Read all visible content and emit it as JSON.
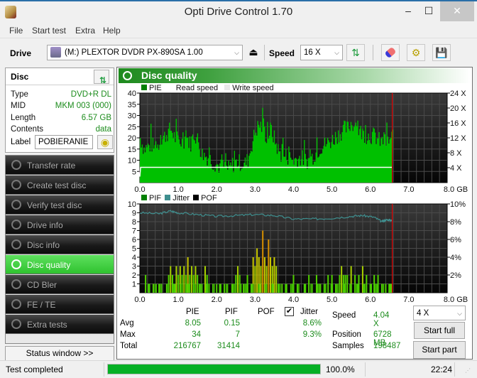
{
  "window": {
    "title": "Opti Drive Control 1.70",
    "controls": {
      "minimize": "‒",
      "maximize": "☐",
      "close": "✕"
    }
  },
  "menu": [
    "File",
    "Start test",
    "Extra",
    "Help"
  ],
  "toolbar": {
    "drive_label": "Drive",
    "drive_value": "(M:)  PLEXTOR DVDR   PX-890SA 1.00",
    "speed_label": "Speed",
    "speed_value": "16 X",
    "icons": [
      "eject-icon",
      "refresh-icon",
      "erase-icon",
      "settings-icon",
      "save-icon"
    ]
  },
  "disc": {
    "header": "Disc",
    "fields": [
      {
        "key": "Type",
        "value": "DVD+R DL"
      },
      {
        "key": "MID",
        "value": "MKM 003 (000)"
      },
      {
        "key": "Length",
        "value": "6.57 GB"
      },
      {
        "key": "Contents",
        "value": "data"
      }
    ],
    "label_key": "Label",
    "label_value": "POBIERANIE"
  },
  "nav": {
    "items": [
      {
        "label": "Transfer rate",
        "active": false
      },
      {
        "label": "Create test disc",
        "active": false
      },
      {
        "label": "Verify test disc",
        "active": false
      },
      {
        "label": "Drive info",
        "active": false
      },
      {
        "label": "Disc info",
        "active": false
      },
      {
        "label": "Disc quality",
        "active": true
      },
      {
        "label": "CD Bler",
        "active": false
      },
      {
        "label": "FE / TE",
        "active": false
      },
      {
        "label": "Extra tests",
        "active": false
      }
    ],
    "status_window_button": "Status window >>"
  },
  "panel": {
    "title": "Disc quality"
  },
  "chart_data": [
    {
      "type": "area",
      "title": "PIE",
      "legend": [
        {
          "name": "PIE",
          "color": "#008000"
        },
        {
          "name": "Read speed",
          "color": "#ffffff"
        },
        {
          "name": "Write speed",
          "color": "#e8e8e8"
        }
      ],
      "legend_placement": "top-left",
      "xlabel": "GB",
      "xlim": [
        0,
        8
      ],
      "x_ticks": [
        "0.0",
        "1.0",
        "2.0",
        "3.0",
        "4.0",
        "5.0",
        "6.0",
        "7.0",
        "8.0 GB"
      ],
      "ylim": [
        0,
        40
      ],
      "y_ticks": [
        "5",
        "10",
        "15",
        "20",
        "25",
        "30",
        "35",
        "40"
      ],
      "y2lim": [
        0,
        24
      ],
      "y2_ticks": [
        "4 X",
        "8 X",
        "12 X",
        "16 X",
        "20 X",
        "24 X"
      ],
      "end_marker_gb": 6.57,
      "series": [
        {
          "name": "PIE",
          "color": "#00c000",
          "x": [
            0.0,
            0.1,
            0.2,
            0.3,
            0.4,
            0.5,
            0.6,
            0.7,
            0.8,
            0.9,
            1.0,
            1.1,
            1.2,
            1.3,
            1.4,
            1.5,
            1.6,
            1.7,
            1.8,
            1.9,
            2.0,
            2.1,
            2.2,
            2.3,
            2.4,
            2.5,
            2.6,
            2.7,
            2.8,
            2.9,
            3.0,
            3.1,
            3.2,
            3.3,
            3.4,
            3.5,
            3.6,
            3.7,
            3.8,
            3.9,
            4.0,
            4.1,
            4.2,
            4.3,
            4.4,
            4.5,
            4.6,
            4.7,
            4.8,
            4.9,
            5.0,
            5.1,
            5.2,
            5.3,
            5.4,
            5.5,
            5.6,
            5.7,
            5.8,
            5.9,
            6.0,
            6.1,
            6.2,
            6.3,
            6.4,
            6.5,
            6.57
          ],
          "values": [
            20,
            15,
            16,
            17,
            15,
            18,
            20,
            22,
            24,
            20,
            19,
            18,
            21,
            17,
            22,
            19,
            13,
            12,
            11,
            9,
            8,
            7,
            7,
            6,
            8,
            9,
            9,
            8,
            10,
            17,
            23,
            26,
            24,
            20,
            24,
            19,
            14,
            12,
            12,
            11,
            10,
            11,
            11,
            10,
            10,
            12,
            14,
            16,
            17,
            18,
            19,
            21,
            22,
            24,
            24,
            27,
            25,
            23,
            22,
            21,
            21,
            21,
            19,
            18,
            18,
            19,
            21
          ]
        },
        {
          "name": "Read speed",
          "color": "#ffffff",
          "x": [
            0.0,
            0.02,
            6.57
          ],
          "values": [
            1.6,
            4.1,
            4.1
          ]
        }
      ]
    },
    {
      "type": "bar",
      "title": "PIF / Jitter",
      "legend": [
        {
          "name": "PIF",
          "color": "#008000"
        },
        {
          "name": "Jitter",
          "color": "#3f8f8f"
        },
        {
          "name": "POF",
          "color": "#000000"
        }
      ],
      "legend_placement": "top-left",
      "xlabel": "GB",
      "xlim": [
        0,
        8
      ],
      "x_ticks": [
        "0.0",
        "1.0",
        "2.0",
        "3.0",
        "4.0",
        "5.0",
        "6.0",
        "7.0",
        "8.0 GB"
      ],
      "ylim": [
        0,
        10
      ],
      "y_ticks": [
        "1",
        "2",
        "3",
        "4",
        "5",
        "6",
        "7",
        "8",
        "9",
        "10"
      ],
      "y2lim": [
        0,
        10
      ],
      "y2_ticks": [
        "2%",
        "4%",
        "6%",
        "8%",
        "10%"
      ],
      "end_marker_gb": 6.57,
      "series": [
        {
          "name": "PIF",
          "x": [
            0.15,
            0.25,
            0.35,
            0.5,
            0.7,
            0.75,
            0.8,
            0.85,
            0.9,
            0.95,
            1.0,
            1.05,
            1.1,
            1.15,
            1.2,
            1.25,
            1.3,
            1.35,
            1.4,
            1.45,
            1.5,
            1.55,
            1.7,
            1.75,
            1.8,
            2.0,
            2.1,
            2.2,
            2.4,
            2.5,
            2.55,
            2.6,
            2.7,
            2.8,
            2.9,
            2.95,
            3.0,
            3.05,
            3.1,
            3.15,
            3.2,
            3.25,
            3.3,
            3.35,
            3.4,
            3.45,
            3.5,
            3.55,
            3.6,
            3.7,
            3.8,
            4.0,
            4.1,
            4.3,
            4.4,
            4.6,
            4.7,
            4.8,
            4.9,
            5.0,
            5.1,
            5.2,
            5.25,
            5.3,
            5.35,
            5.4,
            5.5,
            5.6,
            5.65,
            5.7,
            5.8,
            5.85,
            5.9,
            6.0,
            6.1,
            6.2,
            6.3,
            6.4,
            6.5,
            6.55
          ],
          "values": [
            2,
            1,
            1,
            1,
            1,
            2,
            3,
            2,
            1,
            3,
            2,
            3,
            2,
            3,
            2,
            4,
            2,
            3,
            2,
            3,
            2,
            1,
            3,
            2,
            1,
            1,
            1,
            1,
            1,
            2,
            3,
            2,
            1,
            2,
            1,
            4,
            3,
            5,
            4,
            3,
            7,
            4,
            3,
            6,
            4,
            3,
            4,
            3,
            1,
            1,
            1,
            2,
            1,
            1,
            2,
            2,
            1,
            1,
            2,
            2,
            1,
            2,
            3,
            2,
            2,
            2,
            3,
            2,
            1,
            2,
            3,
            1,
            2,
            1,
            2,
            2,
            1,
            1,
            1,
            1
          ]
        },
        {
          "name": "Jitter",
          "color": "#3f8f8f",
          "x": [
            0.0,
            0.5,
            0.8,
            1.0,
            1.5,
            2.0,
            2.5,
            3.0,
            3.5,
            4.0,
            4.5,
            5.0,
            5.5,
            5.8,
            6.1,
            6.3,
            6.4,
            6.5,
            6.57
          ],
          "values": [
            9.0,
            8.9,
            9.2,
            9.0,
            8.8,
            8.6,
            8.7,
            8.8,
            8.7,
            8.3,
            8.3,
            8.4,
            8.6,
            8.7,
            8.5,
            8.0,
            8.2,
            8.2,
            8.1
          ]
        }
      ]
    }
  ],
  "stats": {
    "headers": [
      "PIE",
      "PIF",
      "POF",
      "Jitter"
    ],
    "jitter_checked": true,
    "rows": [
      {
        "label": "Avg",
        "pie": "8.05",
        "pif": "0.15",
        "pof": "",
        "jitter": "8.6%"
      },
      {
        "label": "Max",
        "pie": "34",
        "pif": "7",
        "pof": "",
        "jitter": "9.3%"
      },
      {
        "label": "Total",
        "pie": "216767",
        "pif": "31414",
        "pof": "",
        "jitter": ""
      }
    ],
    "speed_label": "Speed",
    "speed_value": "4.04 X",
    "position_label": "Position",
    "position_value": "6728 MB",
    "samples_label": "Samples",
    "samples_value": "198487",
    "speed_select": "4 X",
    "start_full": "Start full",
    "start_part": "Start part"
  },
  "statusbar": {
    "message": "Test completed",
    "progress_percent": 100,
    "progress_text": "100.0%",
    "time": "22:24"
  }
}
